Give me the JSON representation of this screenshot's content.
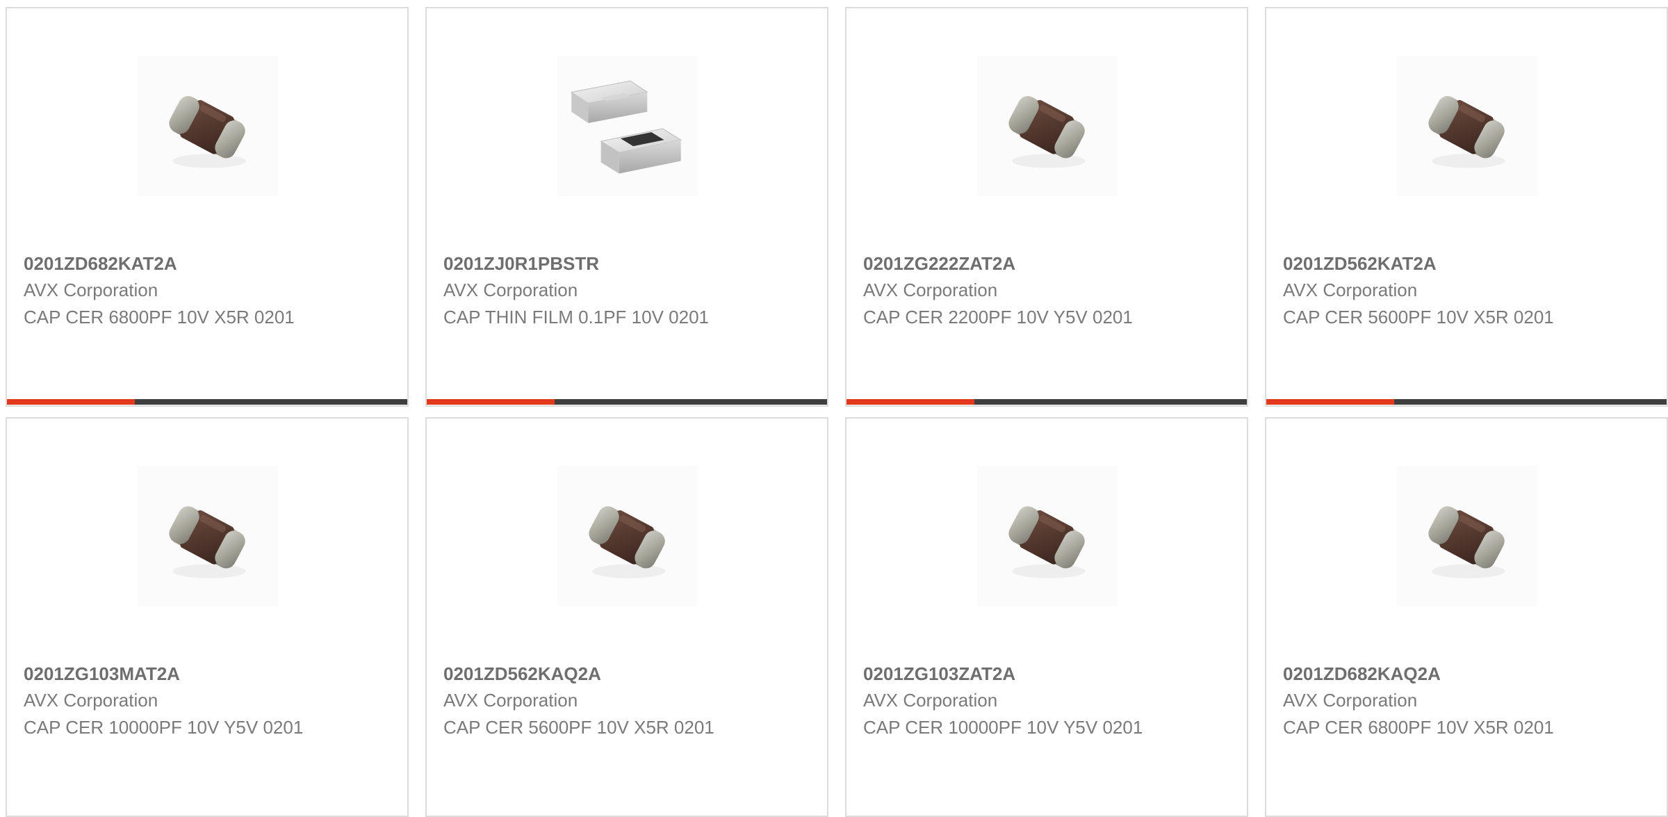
{
  "accent_color": "#e2391c",
  "bar_color": "#3f3f3f",
  "products": [
    {
      "part": "0201ZD682KAT2A",
      "manufacturer": "AVX Corporation",
      "description": "CAP CER 6800PF 10V X5R 0201",
      "image": "ceramic-capacitor-chip-icon"
    },
    {
      "part": "0201ZJ0R1PBSTR",
      "manufacturer": "AVX Corporation",
      "description": "CAP THIN FILM 0.1PF 10V 0201",
      "image": "thin-film-capacitor-chip-icon"
    },
    {
      "part": "0201ZG222ZAT2A",
      "manufacturer": "AVX Corporation",
      "description": "CAP CER 2200PF 10V Y5V 0201",
      "image": "ceramic-capacitor-chip-icon"
    },
    {
      "part": "0201ZD562KAT2A",
      "manufacturer": "AVX Corporation",
      "description": "CAP CER 5600PF 10V X5R 0201",
      "image": "ceramic-capacitor-chip-icon"
    },
    {
      "part": "0201ZG103MAT2A",
      "manufacturer": "AVX Corporation",
      "description": "CAP CER 10000PF 10V Y5V 0201",
      "image": "ceramic-capacitor-chip-icon"
    },
    {
      "part": "0201ZD562KAQ2A",
      "manufacturer": "AVX Corporation",
      "description": "CAP CER 5600PF 10V X5R 0201",
      "image": "ceramic-capacitor-chip-icon"
    },
    {
      "part": "0201ZG103ZAT2A",
      "manufacturer": "AVX Corporation",
      "description": "CAP CER 10000PF 10V Y5V 0201",
      "image": "ceramic-capacitor-chip-icon"
    },
    {
      "part": "0201ZD682KAQ2A",
      "manufacturer": "AVX Corporation",
      "description": "CAP CER 6800PF 10V X5R 0201",
      "image": "ceramic-capacitor-chip-icon"
    }
  ]
}
